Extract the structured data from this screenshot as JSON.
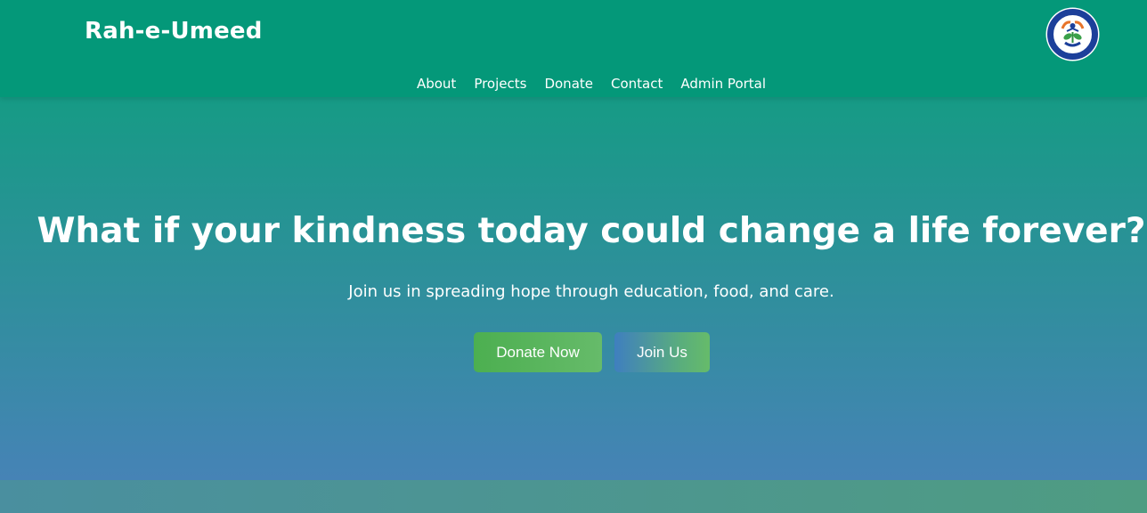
{
  "header": {
    "brand": "Rah-e-Umeed",
    "logo_icon": "organization-logo-icon",
    "nav": [
      {
        "label": "About"
      },
      {
        "label": "Projects"
      },
      {
        "label": "Donate"
      },
      {
        "label": "Contact"
      },
      {
        "label": "Admin Portal"
      }
    ]
  },
  "hero": {
    "title": "What if your kindness today could change a life forever?",
    "subtitle": "Join us in spreading hope through education, food, and care.",
    "buttons": {
      "donate_label": "Donate Now",
      "join_label": "Join Us"
    }
  },
  "colors": {
    "header_bg": "#049879",
    "hero_gradient_top": "#169b85",
    "hero_gradient_bottom": "#4683b6",
    "donate_button": "#4caf50",
    "text": "#ffffff"
  }
}
